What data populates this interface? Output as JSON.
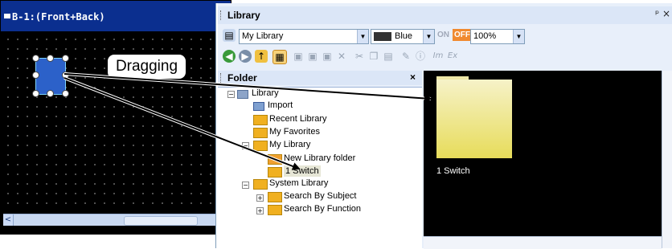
{
  "left_window": {
    "title": "B-1:(Front+Back)"
  },
  "drag_label": "Dragging",
  "library": {
    "title": "Library",
    "library_combo": "My Library",
    "color_combo": "Blue",
    "on_label": "ON",
    "off_label": "OFF",
    "zoom_combo": "100%",
    "folder_header": "Folder",
    "tree": [
      {
        "label": "Library"
      },
      {
        "label": "Import"
      },
      {
        "label": "Recent Library"
      },
      {
        "label": "My Favorites"
      },
      {
        "label": "My Library"
      },
      {
        "label": "New Library folder"
      },
      {
        "label": "1 Switch"
      },
      {
        "label": "System Library"
      },
      {
        "label": "Search By Subject"
      },
      {
        "label": "Search By Function"
      }
    ],
    "preview_item": "1 Switch"
  },
  "colors": {
    "title_bar": "#0b2f8f",
    "object": "#2c61c9",
    "folder": "#f0b020"
  }
}
